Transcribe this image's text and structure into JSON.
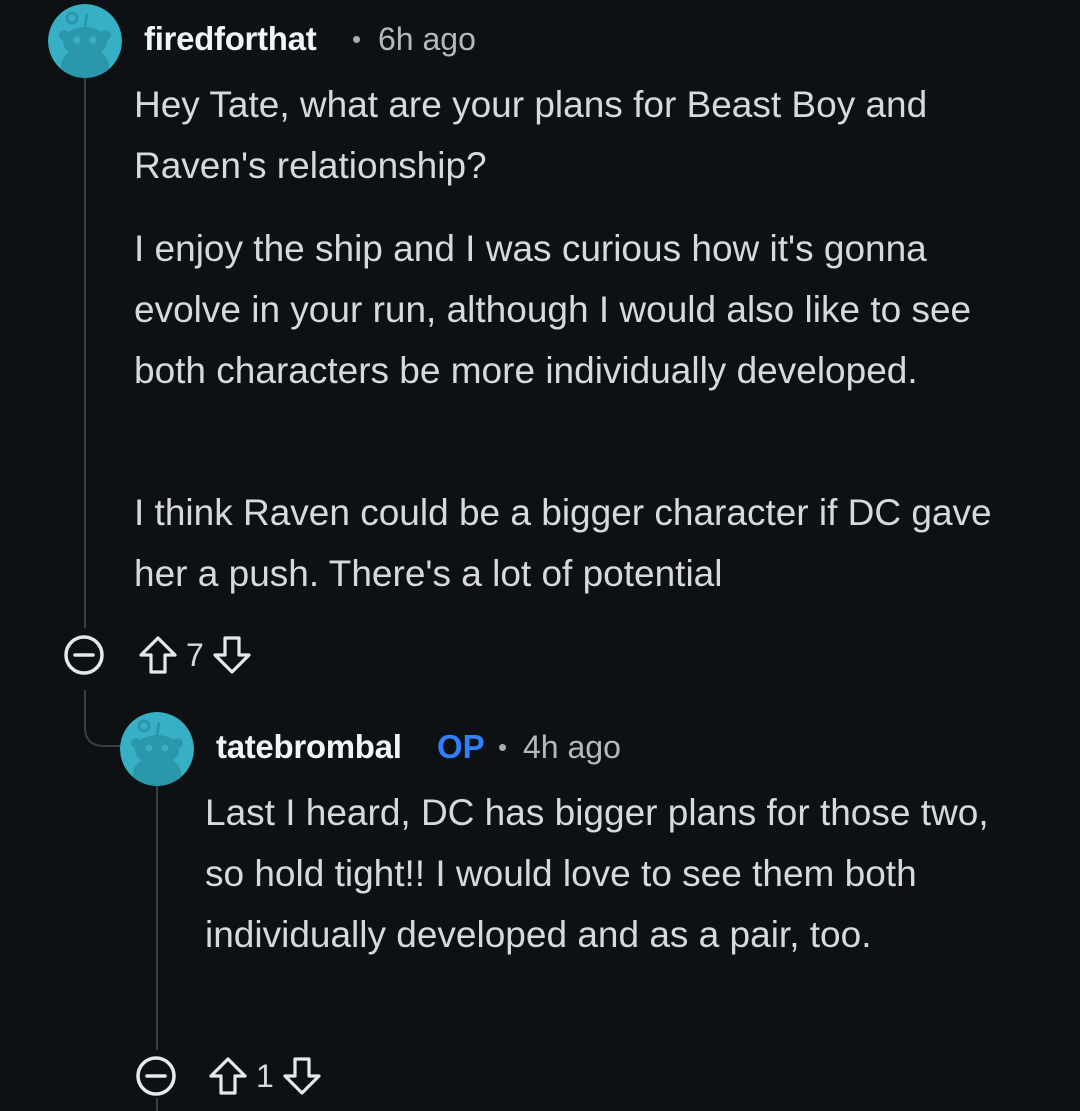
{
  "comments": [
    {
      "username": "firedforthat",
      "separator": "•",
      "time": "6h ago",
      "paragraphs": [
        "Hey Tate, what are your plans for Beast Boy and Raven's relationship?",
        "I enjoy the ship and I was curious how it's gonna evolve in your run, although I would also like to see both characters be more individually developed.",
        "I think Raven could be a bigger character if DC gave her a push. There's a lot of potential"
      ],
      "vote_count": "7",
      "avatar_color": "#37b0c5"
    },
    {
      "username": "tatebrombal",
      "badge": "OP",
      "separator": "•",
      "time": "4h ago",
      "paragraphs": [
        "Last I heard, DC has bigger plans for those two, so hold tight!! I would love to see them both individually developed and as a pair, too."
      ],
      "vote_count": "1",
      "avatar_color": "#37b0c5"
    }
  ],
  "icons": {
    "collapse": "collapse-icon",
    "upvote": "upvote-arrow-icon",
    "downvote": "downvote-arrow-icon",
    "avatar": "snoo-avatar-icon"
  },
  "colors": {
    "background": "#0e1113",
    "op_badge": "#2f7fff",
    "text": "#d7dadc"
  }
}
